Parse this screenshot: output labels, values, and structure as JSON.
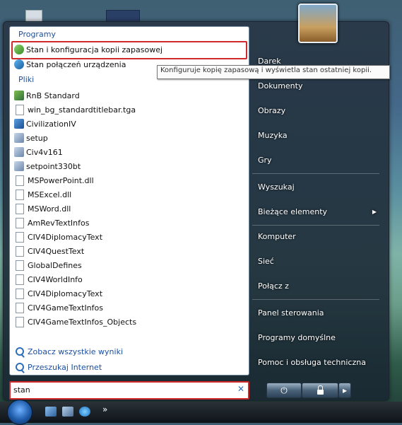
{
  "programs_header": "Programy",
  "programs": [
    {
      "label": "Stan i konfiguracja kopii zapasowej",
      "icon": "backup-icon"
    },
    {
      "label": "Stan połączeń urządzenia",
      "icon": "sync-center-icon"
    }
  ],
  "files_header": "Pliki",
  "files": [
    {
      "label": "RnB Standard",
      "icon": "game-icon"
    },
    {
      "label": "win_bg_standardtitlebar.tga",
      "icon": "document-icon"
    },
    {
      "label": "CivilizationIV",
      "icon": "app-icon"
    },
    {
      "label": "setup",
      "icon": "setup-icon"
    },
    {
      "label": "Civ4v161",
      "icon": "setup-icon"
    },
    {
      "label": "setpoint330bt",
      "icon": "setup-icon"
    },
    {
      "label": "MSPowerPoint.dll",
      "icon": "dll-icon"
    },
    {
      "label": "MSExcel.dll",
      "icon": "dll-icon"
    },
    {
      "label": "MSWord.dll",
      "icon": "dll-icon"
    },
    {
      "label": "AmRevTextInfos",
      "icon": "document-icon"
    },
    {
      "label": "CIV4DiplomacyText",
      "icon": "document-icon"
    },
    {
      "label": "CIV4QuestText",
      "icon": "document-icon"
    },
    {
      "label": "GlobalDefines",
      "icon": "document-icon"
    },
    {
      "label": "CIV4WorldInfo",
      "icon": "document-icon"
    },
    {
      "label": "CIV4DiplomacyText",
      "icon": "document-icon"
    },
    {
      "label": "CIV4GameTextInfos",
      "icon": "document-icon"
    },
    {
      "label": "CIV4GameTextInfos_Objects",
      "icon": "document-icon"
    }
  ],
  "see_all_results": "Zobacz wszystkie wyniki",
  "search_internet": "Przeszukaj Internet",
  "search_value": "stan",
  "clear_symbol": "✕",
  "tooltip": "Konfiguruje kopię zapasową i wyświetla stan ostatniej kopii.",
  "right_pane": {
    "user": "Darek",
    "documents": "Dokumenty",
    "pictures": "Obrazy",
    "music": "Muzyka",
    "games": "Gry",
    "search": "Wyszukaj",
    "recent": "Bieżące elementy",
    "recent_arrow": "▶",
    "computer": "Komputer",
    "network": "Sieć",
    "connect": "Połącz z",
    "control_panel": "Panel sterowania",
    "default_programs": "Programy domyślne",
    "help": "Pomoc i obsługa techniczna"
  },
  "power_symbol": "⏻",
  "arrow_symbol": "▸",
  "quicklaunch_more": "»",
  "colors": {
    "highlight_border": "#d1282c",
    "link": "#1a4fa0",
    "section_header": "#1e4f9a"
  }
}
